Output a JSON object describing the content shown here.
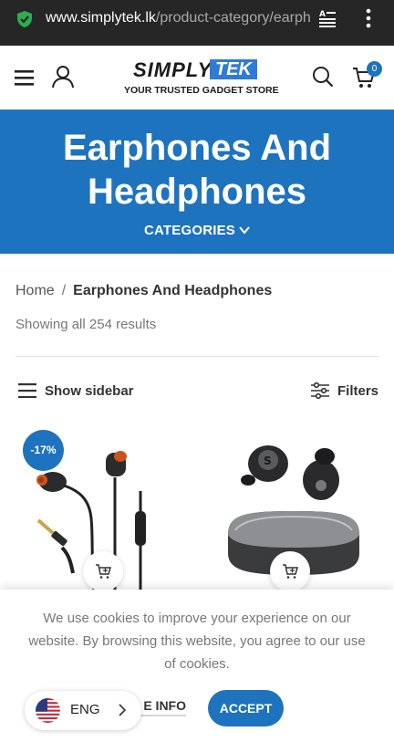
{
  "browser": {
    "url_domain": "www.simplytek.lk",
    "url_path": "/product-category/earphor"
  },
  "header": {
    "logo_simply": "SIMPLY",
    "logo_tek": "TEK",
    "logo_tagline": "YOUR TRUSTED GADGET STORE",
    "cart_count": "0"
  },
  "banner": {
    "title": "Earphones And Headphones",
    "categories_label": "CATEGORIES"
  },
  "breadcrumb": {
    "home": "Home",
    "separator": "/",
    "current": "Earphones And Headphones"
  },
  "results": {
    "count_text": "Showing all 254 results"
  },
  "toolbar": {
    "show_sidebar_label": "Show sidebar",
    "filters_label": "Filters"
  },
  "products": [
    {
      "sale_badge": "-17%"
    },
    {}
  ],
  "cookie": {
    "message": "We use cookies to improve your experience on our website. By browsing this website, you agree to our use of cookies.",
    "more_info_label": "E INFO",
    "accept_label": "ACCEPT"
  },
  "language": {
    "code": "ENG"
  },
  "colors": {
    "brand_blue": "#1e73be",
    "url_bar": "#262626"
  }
}
